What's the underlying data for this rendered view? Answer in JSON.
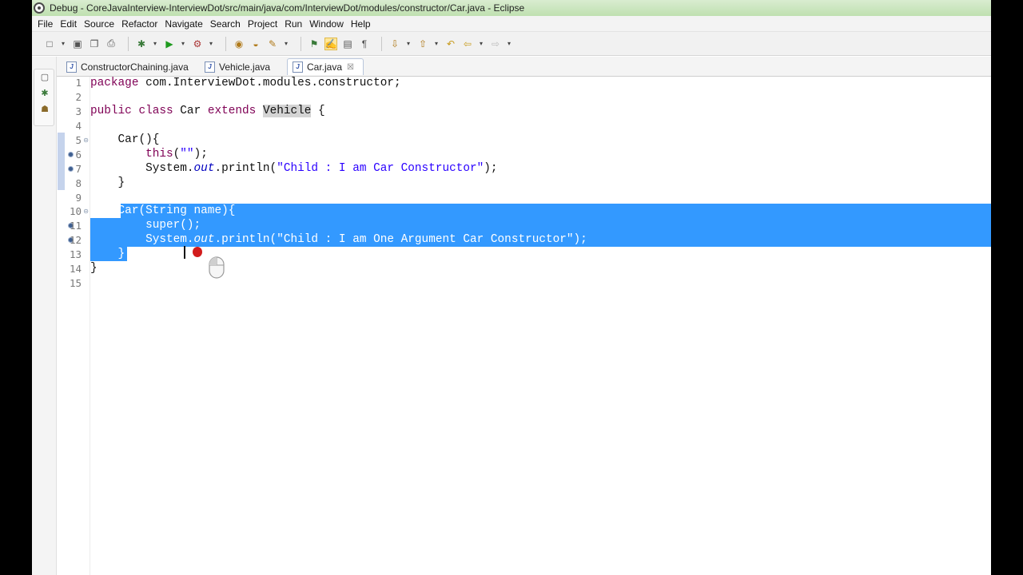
{
  "window": {
    "title": "Debug - CoreJavaInterview-InterviewDot/src/main/java/com/InterviewDot/modules/constructor/Car.java - Eclipse"
  },
  "menu": [
    "File",
    "Edit",
    "Source",
    "Refactor",
    "Navigate",
    "Search",
    "Project",
    "Run",
    "Window",
    "Help"
  ],
  "tabs": [
    {
      "label": "ConstructorChaining.java",
      "active": false
    },
    {
      "label": "Vehicle.java",
      "active": false
    },
    {
      "label": "Car.java",
      "active": true,
      "close": "☒"
    }
  ],
  "editor": {
    "line_numbers": [
      "1",
      "2",
      "3",
      "4",
      "5",
      "6",
      "7",
      "8",
      "9",
      "10",
      "11",
      "12",
      "13",
      "14",
      "15"
    ],
    "lines": {
      "l1_kw": "package",
      "l1_rest": " com.InterviewDot.modules.constructor;",
      "l3_kw1": "public",
      "l3_kw2": "class",
      "l3_mid": " Car ",
      "l3_kw3": "extends",
      "l3_type": "Vehicle",
      "l3_end": " {",
      "l5": "    Car(){",
      "l6_kw": "this",
      "l6_args": "(",
      "l6_str": "\"\"",
      "l6_end": ");",
      "l7_pre": "        System.",
      "l7_fld": "out",
      "l7_mid": ".println(",
      "l7_str": "\"Child : I am Car Constructor\"",
      "l7_end": ");",
      "l8": "    }",
      "l10": "    Car(String name){",
      "l11_kw": "super",
      "l11_end": "();",
      "l12_pre": "        System.",
      "l12_fld": "out",
      "l12_mid": ".println(",
      "l12_str": "\"Child : I am One Argument Car Constructor\"",
      "l12_end": ");",
      "l13": "    }",
      "l14": "}"
    },
    "selection_color": "#3399ff",
    "keyword_color": "#7f0055",
    "string_color": "#2a00ff"
  }
}
